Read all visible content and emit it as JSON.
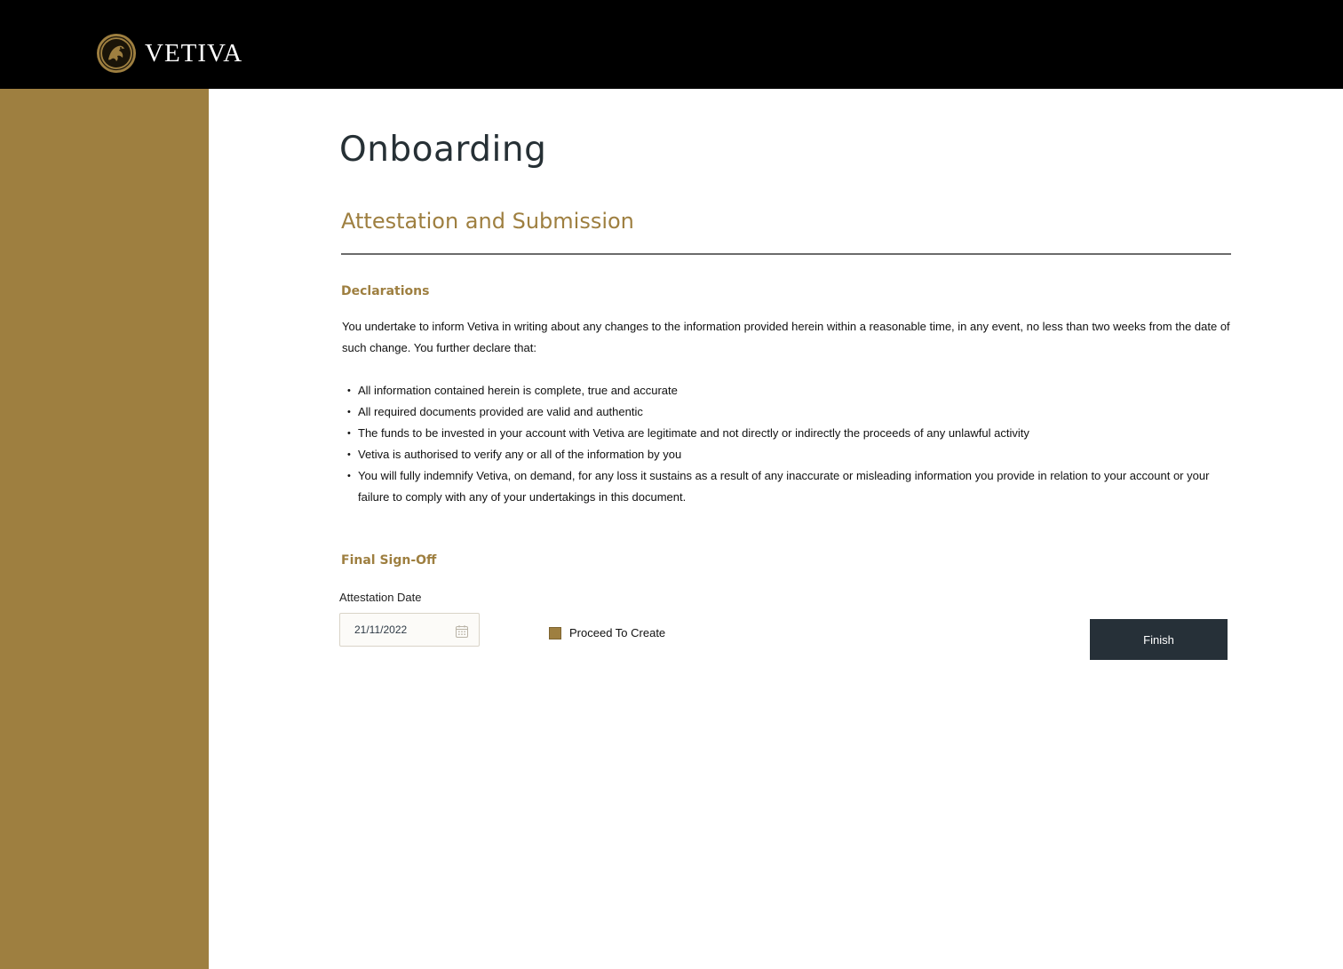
{
  "header": {
    "brand": "VETIVA",
    "logo_icon": "vetiva-emblem-icon"
  },
  "colors": {
    "accent": "#9e7f40",
    "header_bg": "#000000",
    "title": "#263035",
    "button_bg": "#263038"
  },
  "main": {
    "title": "Onboarding",
    "section_title": "Attestation and Submission",
    "declarations": {
      "heading": "Declarations",
      "intro": "You undertake to inform Vetiva in writing about any changes to the information provided herein within a reasonable time, in any event, no less than two weeks from the date of such change. You further declare that:",
      "items": [
        "All information contained herein is complete, true and accurate",
        "All required documents provided are valid and authentic",
        "The funds to be invested in your account with Vetiva are legitimate and not directly or indirectly the proceeds of any unlawful activity",
        "Vetiva is authorised to verify any or all of the information by you",
        "You will fully indemnify Vetiva, on demand, for any loss it sustains as a result of any inaccurate or misleading information you provide in relation to your account or your failure to comply with any of your undertakings in this document."
      ]
    },
    "signoff": {
      "heading": "Final Sign-Off",
      "date_label": "Attestation Date",
      "date_value": "21/11/2022",
      "date_icon": "calendar-icon",
      "checkbox_label": "Proceed To Create",
      "checkbox_checked": true,
      "finish_label": "Finish"
    }
  }
}
